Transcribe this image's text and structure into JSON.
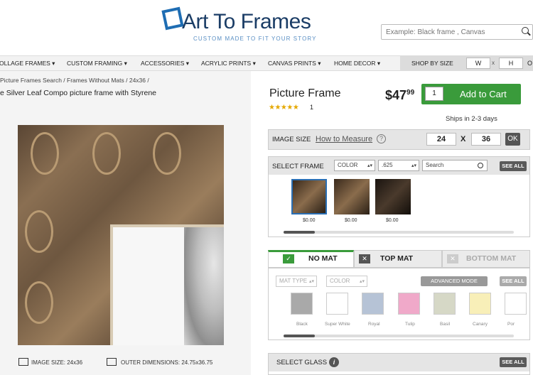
{
  "header": {
    "logo": "Art To Frames",
    "tagline": "CUSTOM MADE TO FIT YOUR STORY",
    "search_placeholder": "Example: Black frame , Canvas"
  },
  "nav": {
    "items": [
      "OLLAGE FRAMES",
      "CUSTOM FRAMING",
      "ACCESSORIES",
      "ACRYLIC PRINTS",
      "CANVAS PRINTS",
      "HOME DECOR"
    ],
    "shop_by_size": "SHOP BY SIZE",
    "w_placeholder": "W",
    "x": "x",
    "h_placeholder": "H",
    "or": "O"
  },
  "breadcrumb": "Picture Frames Search / Frames Without Mats / 24x36 /",
  "product_line": "e Silver Leaf Compo picture frame with Styrene",
  "info": {
    "image_size": "IMAGE SIZE: 24x36",
    "outer_dimensions": "OUTER DIMENSIONS: 24.75x36.75"
  },
  "product": {
    "title": "Picture Frame",
    "stars": "★★★★★",
    "rating_count": "1",
    "price": "$47",
    "price_cents": "99",
    "qty": "1",
    "add_to_cart": "Add to Cart",
    "ships": "Ships in 2-3 days"
  },
  "image_size": {
    "label": "IMAGE SIZE",
    "how_to_measure": "How to Measure",
    "help": "?",
    "width": "24",
    "x": "X",
    "height": "36",
    "ok": "OK"
  },
  "select_frame": {
    "label": "SELECT FRAME",
    "color": "COLOR",
    "width": ".625",
    "search": "Search",
    "see_all": "SEE ALL",
    "prices": [
      "$0.00",
      "$0.00",
      "$0.00"
    ]
  },
  "mats": {
    "tabs": [
      "NO MAT",
      "TOP MAT",
      "BOTTOM MAT"
    ],
    "mat_type": "MAT TYPE",
    "color": "COLOR",
    "advanced": "ADVANCED MODE",
    "see_all": "SEE ALL",
    "swatches": [
      {
        "name": "Black",
        "color": "#a9a9a9"
      },
      {
        "name": "Super White",
        "color": "#ffffff"
      },
      {
        "name": "Royal",
        "color": "#b6c3d6"
      },
      {
        "name": "Tulip",
        "color": "#f0a9c9"
      },
      {
        "name": "Basil",
        "color": "#d6d8c6"
      },
      {
        "name": "Canary",
        "color": "#f8efb8"
      },
      {
        "name": "Por",
        "color": "#ffffff"
      }
    ]
  },
  "glass": {
    "label": "SELECT GLASS",
    "info": "i",
    "see_all": "SEE ALL"
  }
}
